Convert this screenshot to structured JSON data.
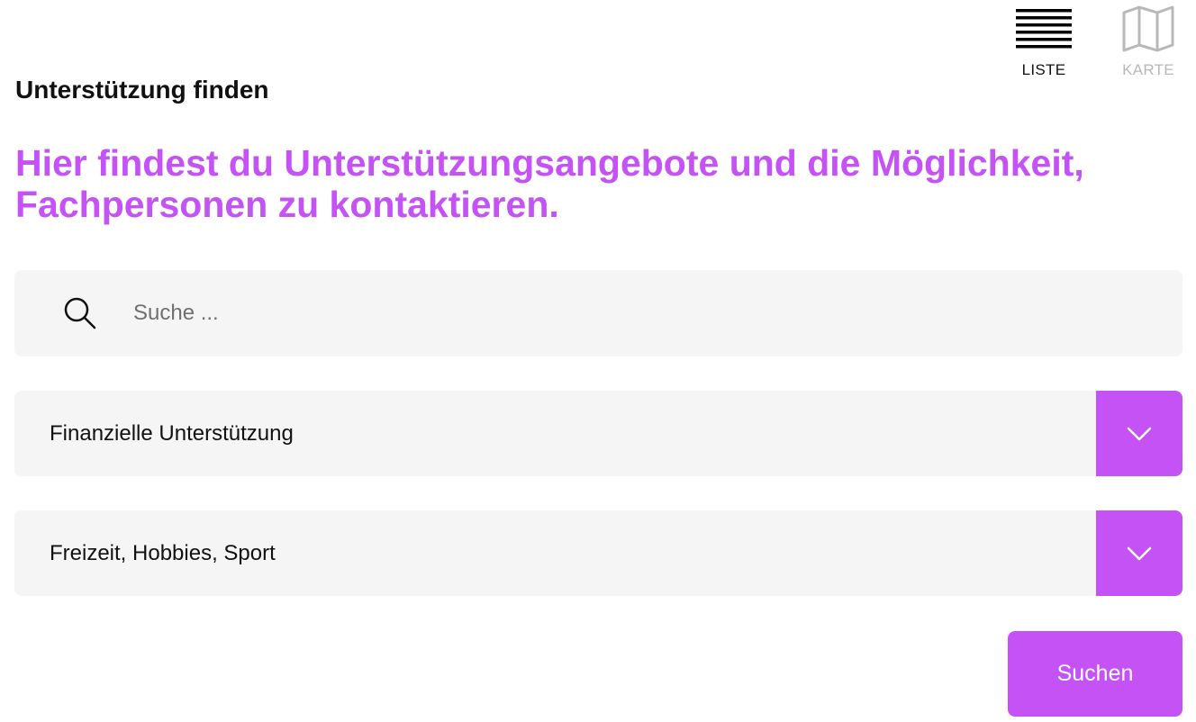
{
  "view_toggle": {
    "list": {
      "label": "LISTE",
      "icon": "list-icon",
      "active": true
    },
    "map": {
      "label": "KARTE",
      "icon": "map-icon",
      "active": false
    }
  },
  "section_title": "Unterstützung finden",
  "headline": "Hier findest du Unterstützungsangebote und die Möglichkeit, Fachpersonen zu kontaktieren.",
  "search": {
    "icon": "search-icon",
    "placeholder": "Suche ...",
    "value": ""
  },
  "filters": [
    {
      "selected": "Finanzielle Unterstützung",
      "icon": "chevron-down-icon"
    },
    {
      "selected": "Freizeit, Hobbies, Sport",
      "icon": "chevron-down-icon"
    }
  ],
  "submit_label": "Suchen",
  "colors": {
    "accent": "#c452f5",
    "field_background": "#f5f5f5",
    "text": "#111111",
    "inactive": "#b8b8b8"
  }
}
